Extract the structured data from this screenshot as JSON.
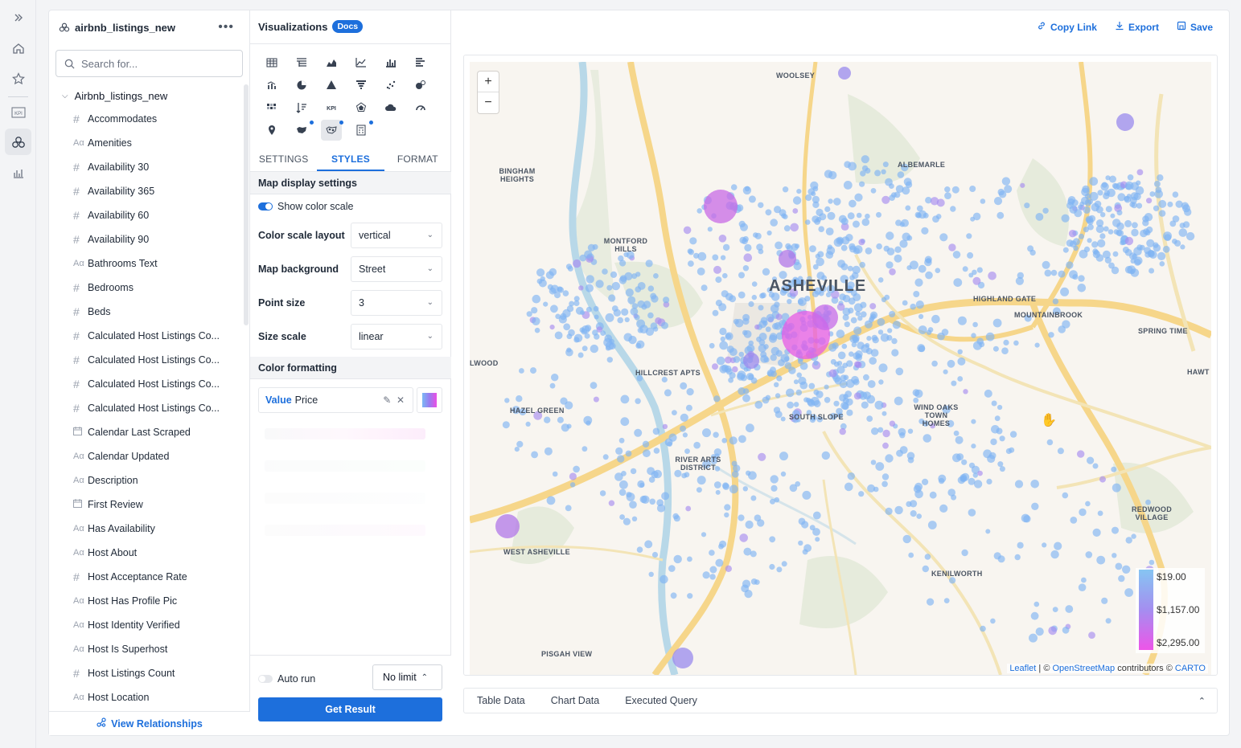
{
  "dataset": {
    "title": "airbnb_listings_new",
    "search_placeholder": "Search for...",
    "root": "Airbnb_listings_new",
    "fields": [
      {
        "type": "#",
        "label": "Accommodates"
      },
      {
        "type": "Aα",
        "label": "Amenities"
      },
      {
        "type": "#",
        "label": "Availability 30"
      },
      {
        "type": "#",
        "label": "Availability 365"
      },
      {
        "type": "#",
        "label": "Availability 60"
      },
      {
        "type": "#",
        "label": "Availability 90"
      },
      {
        "type": "Aα",
        "label": "Bathrooms Text"
      },
      {
        "type": "#",
        "label": "Bedrooms"
      },
      {
        "type": "#",
        "label": "Beds"
      },
      {
        "type": "#",
        "label": "Calculated Host Listings Co..."
      },
      {
        "type": "#",
        "label": "Calculated Host Listings Co..."
      },
      {
        "type": "#",
        "label": "Calculated Host Listings Co..."
      },
      {
        "type": "#",
        "label": "Calculated Host Listings Co..."
      },
      {
        "type": "cal",
        "label": "Calendar Last Scraped"
      },
      {
        "type": "Aα",
        "label": "Calendar Updated"
      },
      {
        "type": "Aα",
        "label": "Description"
      },
      {
        "type": "cal",
        "label": "First Review"
      },
      {
        "type": "Aα",
        "label": "Has Availability"
      },
      {
        "type": "Aα",
        "label": "Host About"
      },
      {
        "type": "#",
        "label": "Host Acceptance Rate"
      },
      {
        "type": "Aα",
        "label": "Host Has Profile Pic"
      },
      {
        "type": "Aα",
        "label": "Host Identity Verified"
      },
      {
        "type": "Aα",
        "label": "Host Is Superhost"
      },
      {
        "type": "#",
        "label": "Host Listings Count"
      },
      {
        "type": "Aα",
        "label": "Host Location"
      }
    ],
    "footer": "View Relationships"
  },
  "viz": {
    "title": "Visualizations",
    "badge": "Docs",
    "tabs": [
      "SETTINGS",
      "STYLES",
      "FORMAT"
    ],
    "section_map": "Map display settings",
    "show_color_scale": "Show color scale",
    "props": [
      {
        "label": "Color scale layout",
        "value": "vertical"
      },
      {
        "label": "Map background",
        "value": "Street"
      },
      {
        "label": "Point size",
        "value": "3"
      },
      {
        "label": "Size scale",
        "value": "linear"
      }
    ],
    "section_color": "Color formatting",
    "cf_value": "Value",
    "cf_field": "Price",
    "auto_run": "Auto run",
    "limit": "No limit",
    "get_result": "Get Result"
  },
  "toolbar": {
    "copy_link": "Copy Link",
    "export": "Export",
    "save": "Save"
  },
  "map": {
    "city": "ASHEVILLE",
    "labels": [
      "WOOLSEY",
      "ALBEMARLE",
      "BINGHAM HEIGHTS",
      "MONTFORD HILLS",
      "HIGHLAND GATE",
      "MOUNTAINBROOK",
      "SPRING TIME",
      "HAWT",
      "LWOOD",
      "HILLCREST APTS",
      "HAZEL GREEN",
      "WIND OAKS TOWN HOMES",
      "SOUTH SLOPE",
      "RIVER ARTS DISTRICT",
      "WEST ASHEVILLE",
      "REDWOOD VILLAGE",
      "KENILWORTH",
      "PISGAH VIEW"
    ],
    "zoom_in": "+",
    "zoom_out": "−",
    "legend": [
      "$19.00",
      "$1,157.00",
      "$2,295.00"
    ],
    "attribution_leaflet": "Leaflet",
    "attribution_mid": " | © ",
    "attribution_osm": "OpenStreetMap",
    "attribution_contrib": " contributors © ",
    "attribution_carto": "CARTO"
  },
  "bottom_tabs": [
    "Table Data",
    "Chart Data",
    "Executed Query"
  ]
}
